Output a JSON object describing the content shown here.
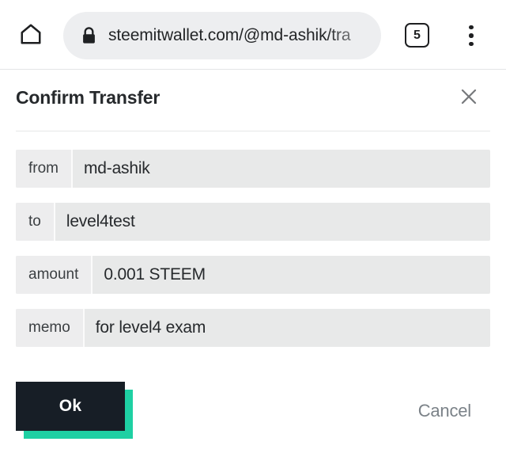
{
  "browser": {
    "home_icon": "home-icon",
    "lock_icon": "lock-icon",
    "url": "steemitwallet.com/@md-ashik/tra",
    "tab_count": "5",
    "menu_icon": "overflow-menu-icon"
  },
  "dialog": {
    "title": "Confirm Transfer",
    "close_icon": "close-icon",
    "fields": [
      {
        "label": "from",
        "value": "md-ashik"
      },
      {
        "label": "to",
        "value": "level4test"
      },
      {
        "label": "amount",
        "value": "0.001 STEEM"
      },
      {
        "label": "memo",
        "value": "for level4 exam"
      }
    ],
    "ok_label": "Ok",
    "cancel_label": "Cancel"
  },
  "colors": {
    "accent_teal": "#1ed0a3",
    "button_dark": "#171e26",
    "field_bg": "#e8e9e9",
    "field_label_bg": "#ededee",
    "url_pill_bg": "#edeef0",
    "cancel_text": "#7b8288"
  }
}
